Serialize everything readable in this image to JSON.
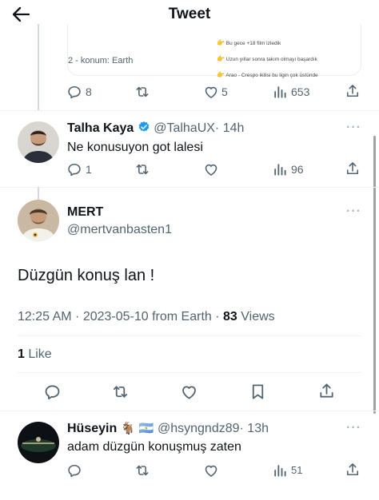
{
  "header": {
    "title": "Tweet"
  },
  "quoted_card": {
    "meta_text": "2 - konum: Earth",
    "items": [
      "Bu gece +18 film izledik",
      "Uzun yıllar sonra takım olmayı başardık",
      "Arao - Crespo ikilisi bu ligin çok üstünde"
    ]
  },
  "top_tweet_actions": {
    "replies": "8",
    "likes": "5",
    "views": "653"
  },
  "reply1": {
    "name": "Talha Kaya",
    "handle": "@TalhaUX",
    "time": "· 14h",
    "text": "Ne konusuyon got lalesi",
    "replies": "1",
    "views": "96"
  },
  "main_tweet": {
    "name": "MERT",
    "handle": "@mertvanbasten1",
    "text": "Düzgün konuş lan !",
    "timestamp": "12:25 AM · 2023-05-10 from Earth · ",
    "views_count": "83",
    "views_label": " Views",
    "likes_count": "1",
    "likes_label": " Like"
  },
  "reply2": {
    "name": "Hüseyin",
    "handle": "@hsyngndz89",
    "time": "· 13h",
    "text": "adam düzgün konuşmuş zaten",
    "views": "51",
    "goat_emoji": "🐐",
    "flag_emoji": "🇦🇷"
  },
  "colors": {
    "verified": "#1d9bf0",
    "text": "#0f1419",
    "secondary": "#536471",
    "divider": "#eff3f4"
  },
  "icons": [
    "back-arrow-icon",
    "reply-icon",
    "retweet-icon",
    "like-icon",
    "views-icon",
    "share-icon",
    "bookmark-icon",
    "verified-badge-icon",
    "more-icon"
  ]
}
